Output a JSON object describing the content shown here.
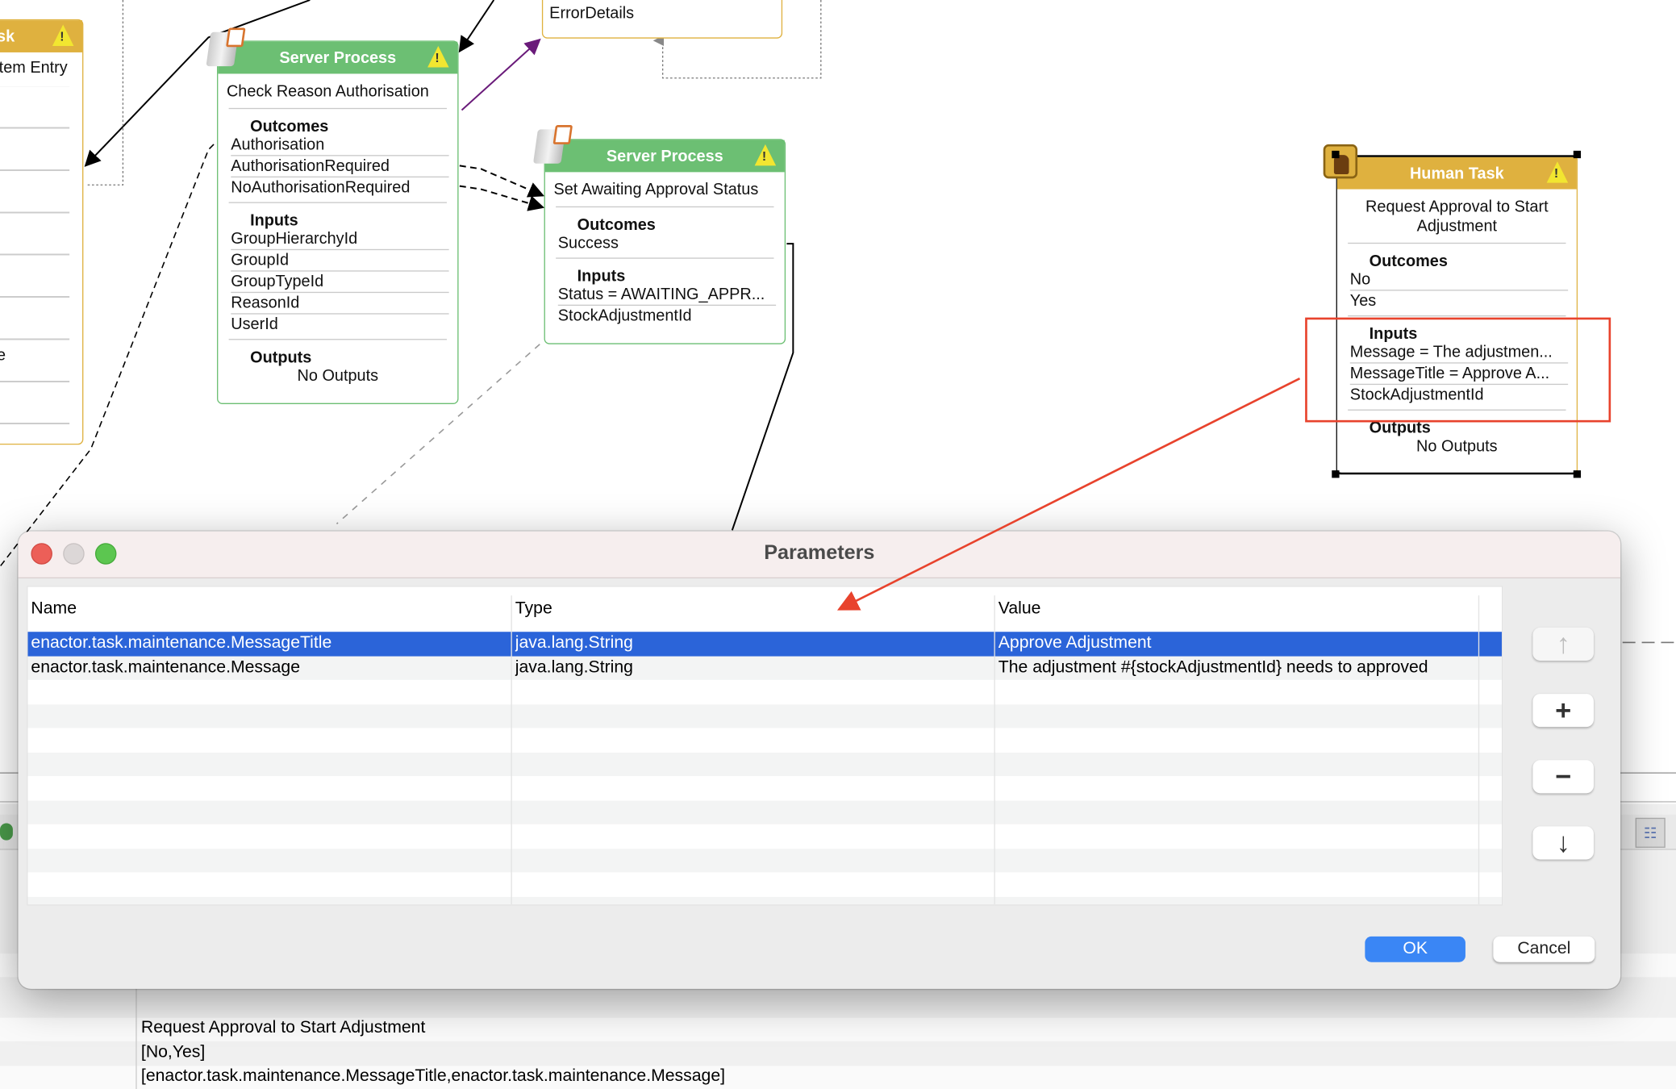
{
  "diagram": {
    "left_task": {
      "header": "sk",
      "title": "tem Entry",
      "partial_item": "e"
    },
    "error_box": {
      "item": "ErrorDetails"
    },
    "server_process_1": {
      "header": "Server Process",
      "title": "Check Reason Authorisation",
      "outcomes_label": "Outcomes",
      "outcomes": [
        "Authorisation",
        "AuthorisationRequired",
        "NoAuthorisationRequired"
      ],
      "inputs_label": "Inputs",
      "inputs": [
        "GroupHierarchyId",
        "GroupId",
        "GroupTypeId",
        "ReasonId",
        "UserId"
      ],
      "outputs_label": "Outputs",
      "outputs": "No Outputs"
    },
    "server_process_2": {
      "header": "Server Process",
      "title": "Set Awaiting Approval Status",
      "outcomes_label": "Outcomes",
      "outcomes": [
        "Success"
      ],
      "inputs_label": "Inputs",
      "inputs": [
        "Status = AWAITING_APPR...",
        "StockAdjustmentId"
      ]
    },
    "human_task": {
      "header": "Human Task",
      "title": "Request Approval to Start Adjustment",
      "outcomes_label": "Outcomes",
      "outcomes": [
        "No",
        "Yes"
      ],
      "inputs_label": "Inputs",
      "inputs": [
        "Message = The adjustmen...",
        "MessageTitle = Approve A...",
        "StockAdjustmentId"
      ],
      "outputs_label": "Outputs",
      "outputs": "No Outputs"
    },
    "annotation_color": "#e8432d",
    "server_color": "#6cbf73",
    "human_color": "#dfb13f"
  },
  "dialog": {
    "title": "Parameters",
    "columns": [
      "Name",
      "Type",
      "Value"
    ],
    "rows": [
      {
        "name": "enactor.task.maintenance.MessageTitle",
        "type": "java.lang.String",
        "value": "Approve Adjustment",
        "selected": true
      },
      {
        "name": "enactor.task.maintenance.Message",
        "type": "java.lang.String",
        "value": "The adjustment #{stockAdjustmentId} needs to approved",
        "selected": false
      }
    ],
    "side_buttons": {
      "up": "move-up",
      "add": "add",
      "remove": "remove",
      "down": "move-down"
    },
    "ok_label": "OK",
    "cancel_label": "Cancel",
    "selection_color": "#2b64d9"
  },
  "properties_panel": {
    "lines": [
      "Request Approval to Start Adjustment",
      "[No,Yes]",
      "[enactor.task.maintenance.MessageTitle,enactor.task.maintenance.Message]"
    ]
  }
}
